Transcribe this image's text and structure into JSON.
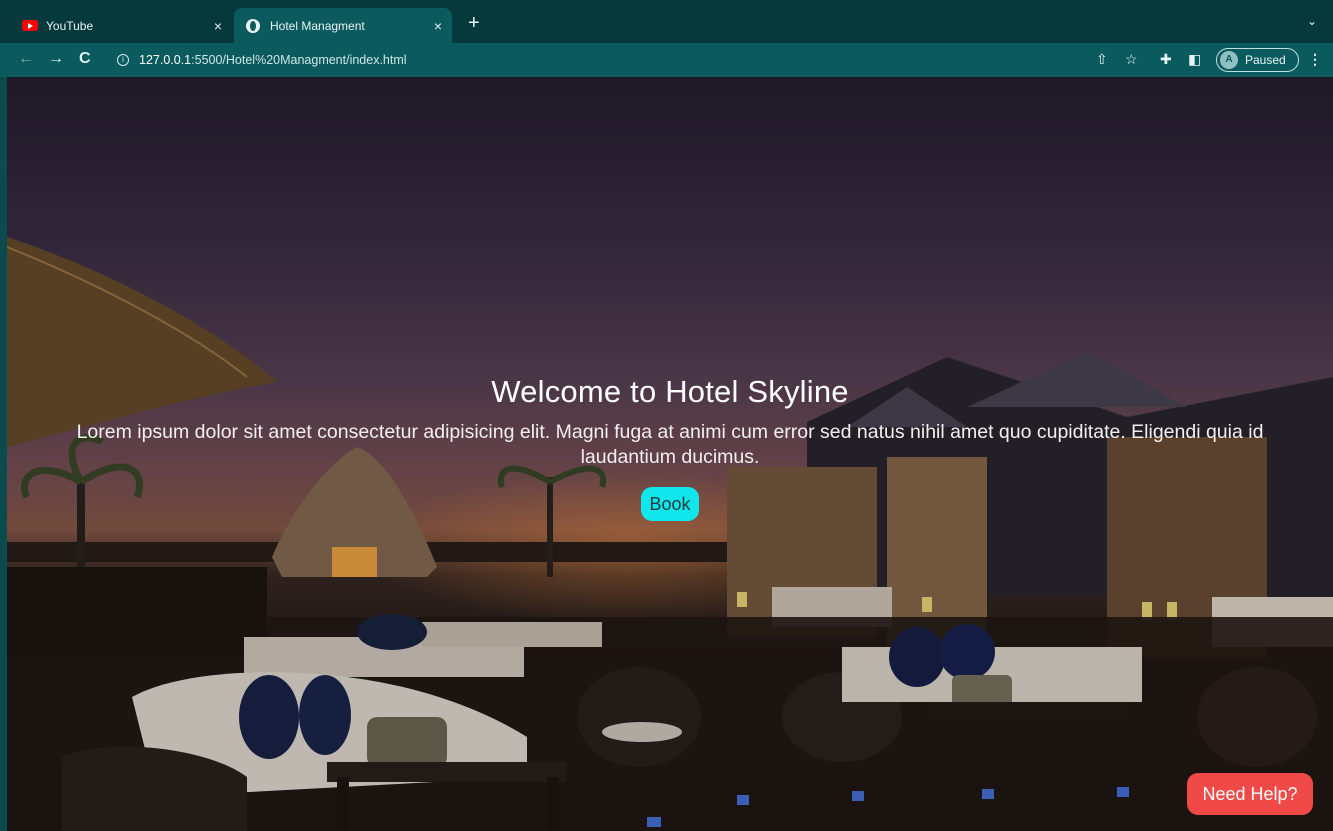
{
  "browser": {
    "tabs": [
      {
        "label": "YouTube",
        "close": "×"
      },
      {
        "label": "Hotel Managment",
        "close": "×"
      }
    ],
    "new_tab": "+",
    "tab_menu": "⌄",
    "nav": {
      "back": "←",
      "forward": "→",
      "reload": "C"
    },
    "url_host": "127.0.0.1",
    "url_path": ":5500/Hotel%20Managment/index.html",
    "profile_initial": "A",
    "profile_status": "Paused",
    "menu": "⋮"
  },
  "hero": {
    "title": "Welcome to Hotel Skyline",
    "text": "Lorem ipsum dolor sit amet consectetur adipisicing elit. Magni fuga at animi cum error sed natus nihil amet quo cupiditate. Eligendi quia id laudantium ducimus.",
    "book_label": "Book"
  },
  "help_label": "Need Help?",
  "colors": {
    "book_button": "#10e7ec",
    "help_button": "#ef4a48",
    "toolbar": "#0b5a5d"
  }
}
